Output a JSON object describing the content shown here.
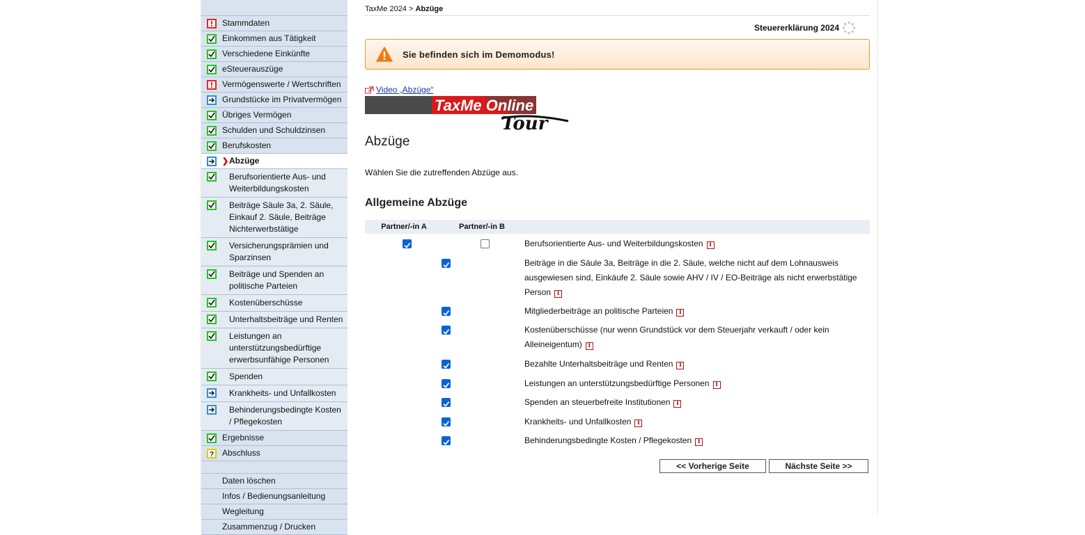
{
  "breadcrumb": {
    "root": "TaxMe 2024",
    "sep": " > ",
    "current": "Abzüge"
  },
  "header": {
    "decl_title": "Steuererklärung 2024"
  },
  "demo": {
    "text": "Sie befinden sich im Demomodus!"
  },
  "video_link": "Video „Abzüge“",
  "banner": {
    "brand": "TaxMe Online",
    "tour": "Tour"
  },
  "page_title": "Abzüge",
  "intro": "Wählen Sie die zutreffenden Abzüge aus.",
  "section_title": "Allgemeine Abzüge",
  "table": {
    "col_a": "Partner/-in A",
    "col_b": "Partner/-in B",
    "rows": [
      {
        "label": "Berufsorientierte Aus- und Weiterbildungskosten",
        "a": true,
        "b": false
      },
      {
        "label": "Beiträge in die Säule 3a, Beiträge in die 2. Säule, welche nicht auf dem Lohnausweis ausgewiesen sind, Einkäufe 2. Säule sowie AHV / IV / EO-Beiträge als nicht erwerbstätige Person",
        "mid": true
      },
      {
        "label": "Mitgliederbeiträge an politische Parteien",
        "mid": true
      },
      {
        "label": "Kostenüberschüsse (nur wenn Grundstück vor dem Steuerjahr verkauft / oder kein Alleineigentum)",
        "mid": true
      },
      {
        "label": "Bezahlte Unterhaltsbeiträge und Renten",
        "mid": true
      },
      {
        "label": "Leistungen an unterstützungsbedürftige Personen",
        "mid": true
      },
      {
        "label": "Spenden an steuerbefreite Institutionen",
        "mid": true
      },
      {
        "label": "Krankheits- und Unfallkosten",
        "mid": true
      },
      {
        "label": "Behinderungsbedingte Kosten / Pflegekosten",
        "mid": true
      }
    ]
  },
  "info_glyph": "i",
  "buttons": {
    "prev": "<< Vorherige Seite",
    "next": "Nächste Seite >>"
  },
  "sidebar": {
    "items": [
      {
        "label": "Stammdaten",
        "status": "red"
      },
      {
        "label": "Einkommen aus Tätigkeit",
        "status": "green"
      },
      {
        "label": "Verschiedene Einkünfte",
        "status": "green"
      },
      {
        "label": "eSteuerauszüge",
        "status": "green"
      },
      {
        "label": "Vermögenswerte / Wertschriften",
        "status": "red"
      },
      {
        "label": "Grundstücke im Privatvermögen",
        "status": "blue"
      },
      {
        "label": "Übriges Vermögen",
        "status": "green"
      },
      {
        "label": "Schulden und Schuldzinsen",
        "status": "green"
      },
      {
        "label": "Berufskosten",
        "status": "green"
      },
      {
        "label": "Abzüge",
        "status": "blue",
        "active": true
      }
    ],
    "subitems": [
      {
        "label": "Berufsorientierte Aus- und Weiterbildungskosten",
        "lines": 2
      },
      {
        "label": "Beiträge Säule 3a, 2. Säule, Einkauf 2. Säule, Beiträge Nichterwerbstätige",
        "lines": 3
      },
      {
        "label": "Versicherungsprämien und Sparzinsen",
        "lines": 2
      },
      {
        "label": "Beiträge und Spenden an politische Parteien",
        "lines": 2
      },
      {
        "label": "Kostenüberschüsse",
        "lines": 1
      },
      {
        "label": "Unterhaltsbeiträge und Renten",
        "lines": 1
      },
      {
        "label": "Leistungen an unterstützungsbedürftige erwerbsunfähige Personen",
        "lines": 3
      },
      {
        "label": "Spenden",
        "lines": 1,
        "status": "green"
      },
      {
        "label": "Krankheits- und Unfallkosten",
        "lines": 1,
        "status": "blue"
      },
      {
        "label": "Behinderungsbedingte Kosten / Pflegekosten",
        "lines": 2,
        "status": "blue"
      }
    ],
    "after": [
      {
        "label": "Ergebnisse",
        "status": "green"
      },
      {
        "label": "Abschluss",
        "status": "yellow"
      }
    ],
    "utilities": [
      "Daten löschen",
      "Infos / Bedienungsanleitung",
      "Wegleitung",
      "Zusammenzug / Drucken"
    ]
  },
  "colors": {
    "accent_green": "#22c322",
    "accent_red": "#e22222",
    "accent_blue": "#2b8fd9",
    "accent_yellow": "#f2c300",
    "sidebar_bg": "#d9e3ef",
    "demo_border": "#e69a3c"
  }
}
